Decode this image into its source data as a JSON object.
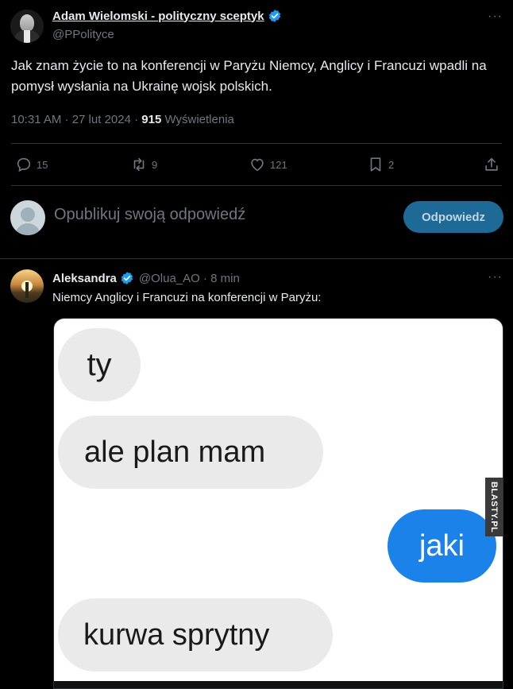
{
  "main_tweet": {
    "author_name": "Adam Wielomski - polityczny sceptyk",
    "handle": "@PPolityce",
    "more_label": "···",
    "text": "Jak znam życie to na konferencji w Paryżu Niemcy, Anglicy i Francuzi wpadli na pomysł wysłania na Ukrainę wojsk polskich.",
    "timestamp": "10:31 AM · 27 lut 2024 · ",
    "views_count": "915",
    "views_label": " Wyświetlenia"
  },
  "actions": {
    "replies": "15",
    "retweets": "9",
    "likes": "121",
    "bookmarks": "2"
  },
  "composer": {
    "placeholder": "Opublikuj swoją odpowiedź",
    "reply_button": "Odpowiedz"
  },
  "reply_tweet": {
    "author_name": "Aleksandra",
    "handle_time": "@Olua_AO · 8 min",
    "more_label": "···",
    "text": "Niemcy Anglicy i Francuzi na konferencji w Paryżu:"
  },
  "meme": {
    "bubbles": [
      "ty",
      "ale plan mam",
      "jaki",
      "kurwa sprytny"
    ],
    "watermark": "BLASTY.PL"
  },
  "colors": {
    "background": "#000000",
    "text": "#e7e9ea",
    "muted": "#71767b",
    "accent": "#1d9bf0",
    "reply_button_bg": "#1d6a96",
    "divider": "#2f3336"
  }
}
